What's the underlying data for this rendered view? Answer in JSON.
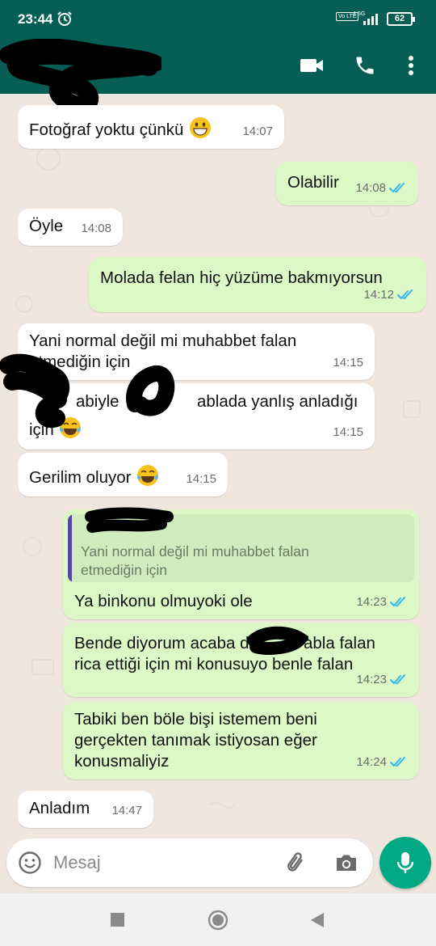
{
  "status_bar": {
    "time": "23:44",
    "volte": "Vo LTE",
    "network": "4.5G",
    "battery": "62",
    "icons": [
      "alarm-icon",
      "signal-icon",
      "battery-icon"
    ]
  },
  "app_bar": {
    "background": "#075e54",
    "icons": [
      "back-arrow-icon",
      "video-call-icon",
      "phone-icon",
      "more-vert-icon"
    ]
  },
  "messages": [
    {
      "dir": "in",
      "text": "Fotoğraf yoktu çünkü",
      "time": "14:07",
      "emoji": "grin"
    },
    {
      "dir": "out",
      "text": "Olabilir",
      "time": "14:08",
      "read": true
    },
    {
      "dir": "in",
      "text": "Öyle",
      "time": "14:08"
    },
    {
      "dir": "out",
      "text": "Molada felan hiç yüzüme bakmıyorsun",
      "time": "14:12",
      "read": true
    },
    {
      "dir": "in",
      "text": "Yani normal değil mi muhabbet falan\netmediğin için",
      "time": "14:15"
    },
    {
      "dir": "in",
      "text": "abiyle",
      "text2": "ablada yanlış anladığı",
      "text3": "için",
      "time": "14:15",
      "emoji": "joy"
    },
    {
      "dir": "in",
      "text": "Gerilim oluyor",
      "time": "14:15",
      "emoji": "joy"
    },
    {
      "dir": "out",
      "quoted": "Yani normal değil mi muhabbet falan\netmediğin için",
      "text": "Ya binkonu olmuyoki ole",
      "time": "14:23",
      "read": true
    },
    {
      "dir": "out",
      "text": "Bende diyorum acaba d",
      "text2": "abla falan",
      "text3": "rica ettiği için mi konusuyo benle falan",
      "time": "14:23",
      "read": true
    },
    {
      "dir": "out",
      "text": "Tabiki ben böle bişi istemem beni\ngerçekten tanımak istiyosan eğer\nkonusmaliyiz",
      "time": "14:24",
      "read": true
    },
    {
      "dir": "in",
      "text": "Anladım",
      "time": "14:47"
    }
  ],
  "composer": {
    "placeholder": "Mesaj",
    "icons": [
      "emoji-icon",
      "attach-icon",
      "camera-icon",
      "mic-icon"
    ]
  },
  "colors": {
    "header": "#075e54",
    "outgoing_bubble": "#dcf8c6",
    "incoming_bubble": "#ffffff",
    "read_ticks": "#34b7f1",
    "mic_button": "#00a884",
    "chat_background": "#efe7de"
  }
}
